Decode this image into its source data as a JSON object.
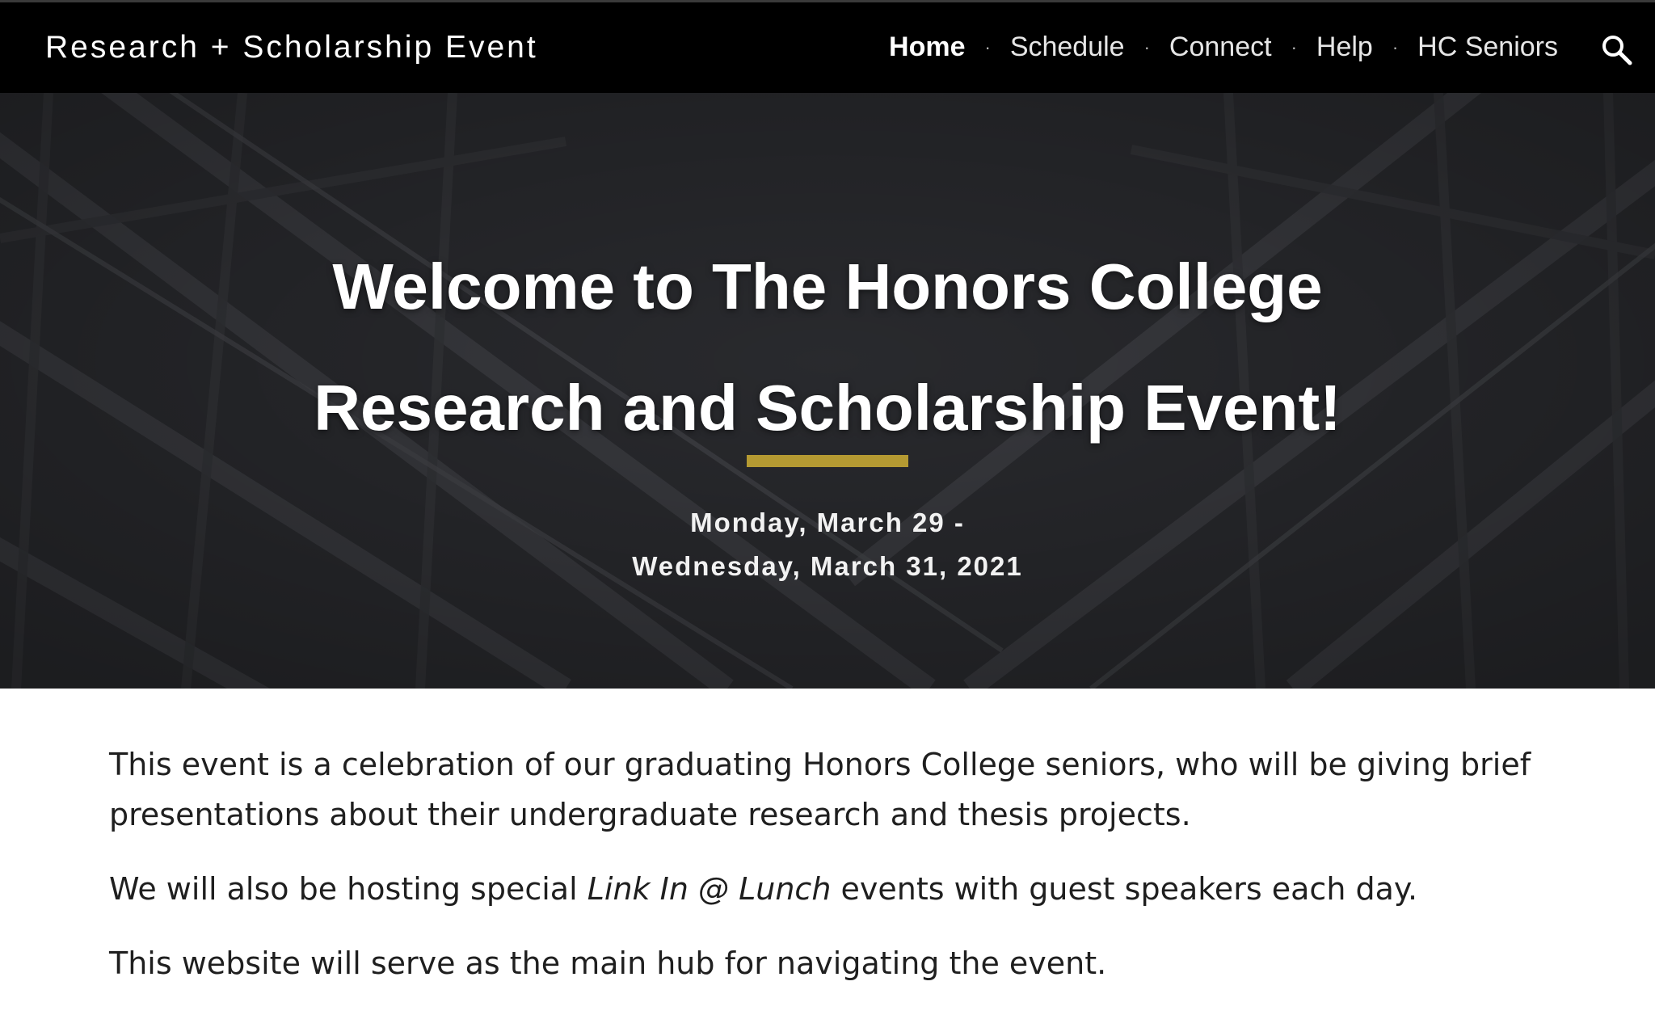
{
  "header": {
    "site_title": "Research + Scholarship Event",
    "nav": [
      {
        "label": "Home",
        "active": true
      },
      {
        "label": "Schedule",
        "active": false
      },
      {
        "label": "Connect",
        "active": false
      },
      {
        "label": "Help",
        "active": false
      },
      {
        "label": "HC Seniors",
        "active": false
      }
    ],
    "separator": "·",
    "search_icon": "search-icon"
  },
  "hero": {
    "title_line1": "Welcome to The Honors College",
    "title_line2": "Research and Scholarship Event!",
    "date_line1": "Monday, March 29 -",
    "date_line2": "Wednesday, March 31, 2021",
    "accent_color": "#b59a32"
  },
  "content": {
    "p1": "This event is a celebration of our graduating Honors College seniors, who will be giving brief presentations about their undergraduate research and thesis projects.",
    "p2_before": "We will also be hosting special ",
    "p2_italic": "Link In @ Lunch",
    "p2_after": " events with guest speakers each day.",
    "p3": "This website will serve as the main hub for navigating the event."
  }
}
